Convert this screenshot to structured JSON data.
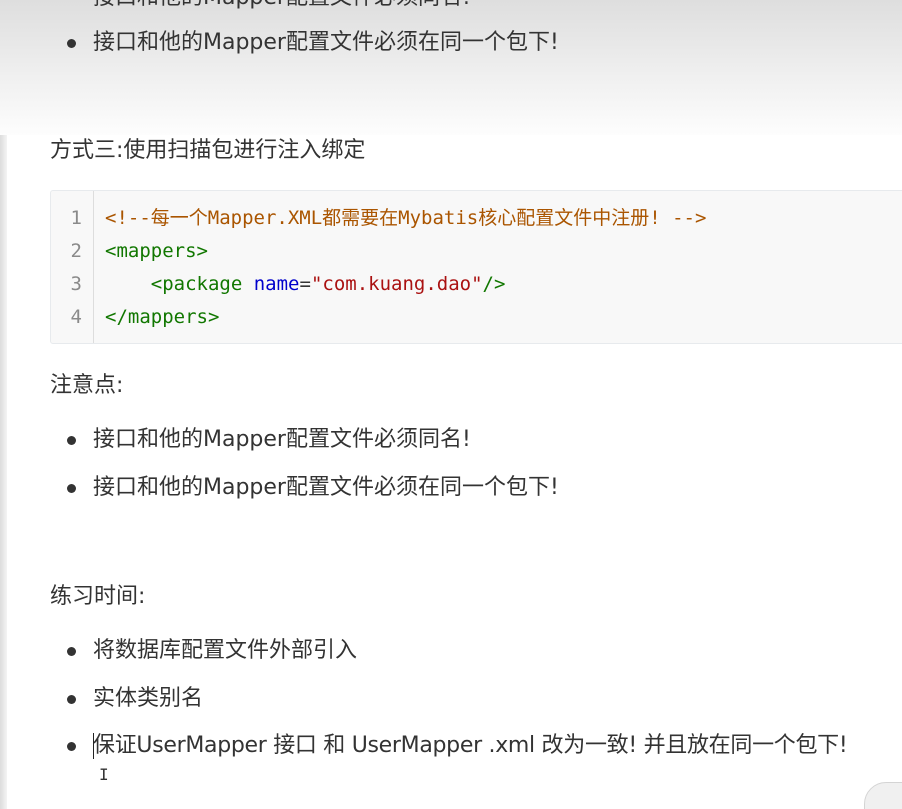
{
  "top_cut_text": "接口和他的Mapper配置文件必须同名!",
  "top_bullets": [
    "接口和他的Mapper配置文件必须在同一个包下!"
  ],
  "method_heading": "方式三:使用扫描包进行注入绑定",
  "code": {
    "line_numbers": [
      "1",
      "2",
      "3",
      "4"
    ],
    "line1_comment": "<!--每一个Mapper.XML都需要在Mybatis核心配置文件中注册! -->",
    "line2_tag": "<mappers>",
    "line3_indent": "    ",
    "line3_tag_open": "<package",
    "line3_attr": "name",
    "line3_eq": "=",
    "line3_value": "\"com.kuang.dao\"",
    "line3_tag_close": "/>",
    "line4_tag": "</mappers>"
  },
  "notes_heading": "注意点:",
  "notes": [
    "接口和他的Mapper配置文件必须同名!",
    "接口和他的Mapper配置文件必须在同一个包下!"
  ],
  "practice_heading": "练习时间:",
  "practice": [
    "将数据库配置文件外部引入",
    "实体类别名",
    "保证UserMapper 接口 和 UserMapper .xml 改为一致! 并且放在同一个包下!"
  ],
  "cursor_glyph": "I"
}
